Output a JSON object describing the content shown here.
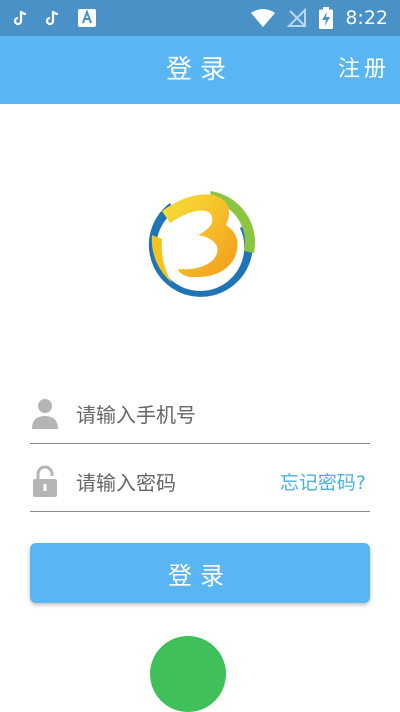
{
  "status_bar": {
    "time": "8:22",
    "icons": [
      "tiktok-icon",
      "tiktok-icon",
      "font-a-icon",
      "wifi-icon",
      "no-signal-icon",
      "battery-charging-icon"
    ]
  },
  "toolbar": {
    "title": "登录",
    "register_label": "注册"
  },
  "form": {
    "phone": {
      "value": "",
      "placeholder": "请输入手机号",
      "icon": "user-icon"
    },
    "password": {
      "value": "",
      "placeholder": "请输入密码",
      "icon": "lock-icon"
    },
    "forgot_label": "忘记密码?",
    "login_label": "登录"
  },
  "colors": {
    "status_bar": "#4a91c8",
    "primary": "#5ab6f2",
    "link": "#4ab1e4",
    "wechat": "#3fc05a"
  },
  "extra": {
    "partial_icon": "wechat-icon"
  }
}
